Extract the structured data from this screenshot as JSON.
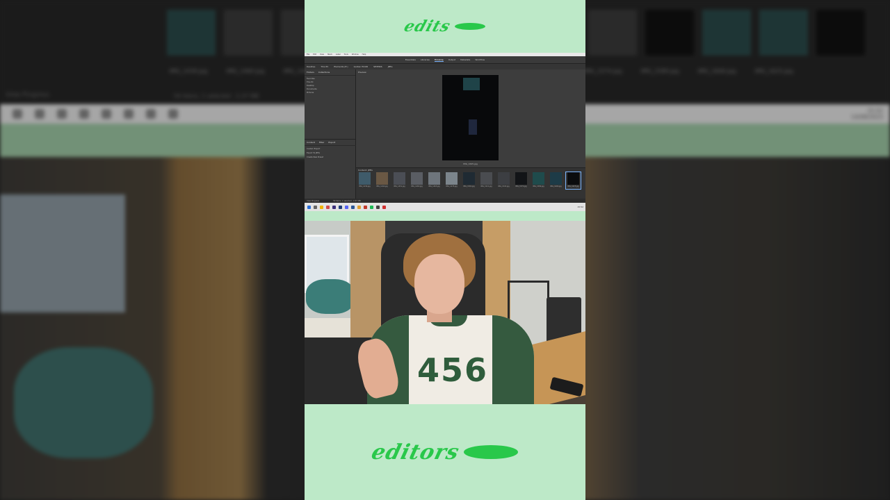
{
  "background": {
    "thumb_names": [
      "IMG_1439.jpg",
      "IMG_1460.jpg",
      "IMG_1465.jpg",
      "IMG_1574.jpg",
      "IMG_1589.jpg",
      "IMG_1606.jpg",
      "IMG_1625.jpg"
    ],
    "view_progress": "View Progress",
    "status": "59 items, 1 selected - 2,37 MB",
    "clock_time": "15:52",
    "clock_date": "14/08/2023"
  },
  "logo": {
    "top_text": "edits",
    "bottom_text": "editors"
  },
  "app": {
    "menu": [
      "File",
      "Edit",
      "View",
      "Stack",
      "Label",
      "Tools",
      "Window",
      "Help"
    ],
    "workspace_tabs": [
      {
        "label": "Essentials",
        "active": false
      },
      {
        "label": "Libraries",
        "active": false
      },
      {
        "label": "Filmstrip",
        "active": true
      },
      {
        "label": "Output",
        "active": false
      },
      {
        "label": "Metadata",
        "active": false
      },
      {
        "label": "Workflow",
        "active": false
      }
    ],
    "path": [
      "Desktop",
      "This PC",
      "Elements (E:)",
      "Golden HOUR",
      "SEVERIS",
      "JPEG"
    ],
    "left_tabs": [
      "Folders",
      "Collections"
    ],
    "left_items": [
      "Favorites",
      "This PC",
      "Desktop",
      "Documents",
      "Pictures"
    ],
    "lower_tabs": [
      "Content",
      "Filter",
      "Export"
    ],
    "lower_items": [
      "Custom Export",
      "Export To JPEG",
      "Create New Preset"
    ],
    "preview_label": "Preview",
    "preview_name": "IMG_1625.jpg",
    "filmstrip_head": "Content: JPEG",
    "thumbs": [
      "IMG_1439.jpg",
      "IMG_1444.jpg",
      "IMG_1451.jpg",
      "IMG_1460.jpg",
      "IMG_1465.jpg",
      "IMG_1478.jpg",
      "IMG_1502.jpg",
      "IMG_1521.jpg",
      "IMG_1543.jpg",
      "IMG_1574.jpg",
      "IMG_1589.jpg",
      "IMG_1606.jpg",
      "IMG_1625.jpg"
    ],
    "status": "59 items, 1 selected - 2,37 MB",
    "view_progress": "View Progress",
    "clock": "15:52"
  },
  "webcam": {
    "shirt_number": "456"
  }
}
